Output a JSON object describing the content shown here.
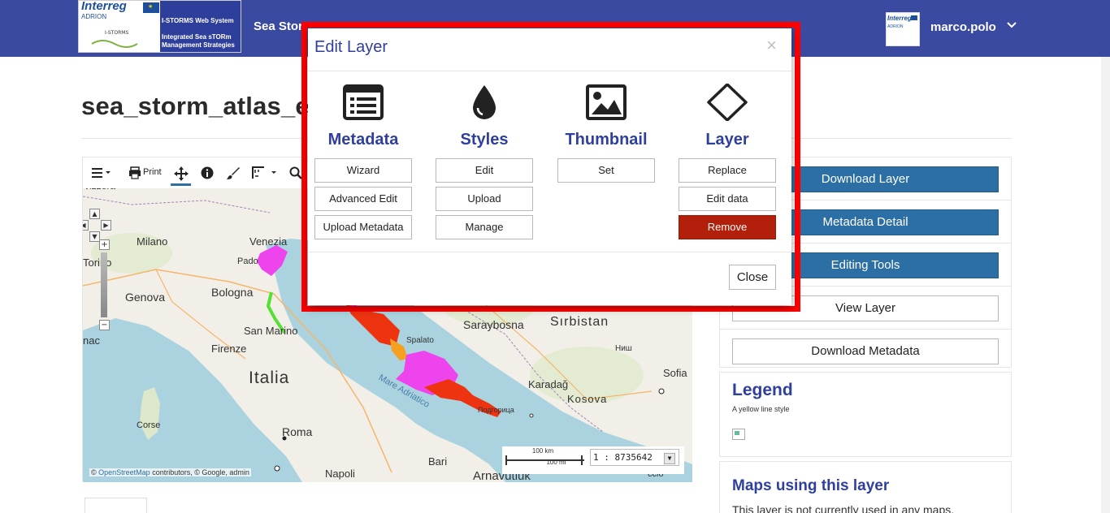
{
  "header": {
    "logo": {
      "interreg": "Interreg",
      "adrion": "ADRION",
      "istorms_small": "I-STORMS",
      "system_name": "I-STORMS Web System",
      "strategy": "Integrated Sea sTORm Management Strategies"
    },
    "brand_text": "Sea Stor",
    "user": {
      "avatar_text": "Interreg",
      "avatar_sub": "ADRION",
      "name": "marco.polo"
    },
    "colors": {
      "nav_bg": "#3a4aa0",
      "accent": "#2f3f9d",
      "primary_button": "#2c6fa5",
      "danger_button": "#b21f0a",
      "highlight": "#ff0000"
    }
  },
  "page": {
    "title": "sea_storm_atlas_e"
  },
  "map": {
    "toolbar": {
      "print_label": "Print",
      "icons": [
        "menu-icon",
        "print-icon",
        "pan-icon",
        "info-icon",
        "brush-icon",
        "measure-icon",
        "zoom-icon"
      ]
    },
    "labels": {
      "svizzera": "vizzera",
      "milano": "Milano",
      "venezia": "Venezia",
      "padova": "Pado",
      "torino": "Torino",
      "bologna": "Bologna",
      "genova": "Genova",
      "san_marino": "San Marino",
      "firenze": "Firenze",
      "italia": "Italia",
      "monaco": "nac",
      "corse": "Corse",
      "roma": "Roma",
      "napoli": "Napoli",
      "bari": "Bari",
      "arnavutluk": "Arnavutluk",
      "spalato": "Spalato",
      "saraybosna": "Saraybosna",
      "sirbistan": "Sırbistan",
      "nis": "Ниш",
      "sofia": "Sofia",
      "karadag": "Karadağ",
      "kosova": "Kosova",
      "podgorica": "Подгорица",
      "mare_adriatico": "Mare Adriatico",
      "ccio": "ccio",
      "ebrenik": "E..Urek"
    },
    "attribution": {
      "copyright": "©",
      "osm_link": "OpenStreetMap",
      "rest": "contributors, © Google, admin"
    },
    "scale": {
      "km": "100 km",
      "mi": "100 mi",
      "ratio": "1 : 8735642"
    }
  },
  "side": {
    "buttons": [
      {
        "label": "Download Layer",
        "style": "primary"
      },
      {
        "label": "Metadata Detail",
        "style": "primary"
      },
      {
        "label": "Editing Tools",
        "style": "primary"
      },
      {
        "label": "View Layer",
        "style": "default"
      },
      {
        "label": "Download Metadata",
        "style": "default"
      }
    ],
    "legend": {
      "title": "Legend",
      "subtitle": "A yellow line style"
    },
    "maps_using": {
      "title": "Maps using this layer",
      "text": "This layer is not currently used in any maps."
    }
  },
  "modal": {
    "title": "Edit Layer",
    "close_x": "×",
    "columns": [
      {
        "heading": "Metadata",
        "icon": "list-icon",
        "buttons": [
          {
            "label": "Wizard"
          },
          {
            "label": "Advanced Edit"
          },
          {
            "label": "Upload Metadata"
          }
        ]
      },
      {
        "heading": "Styles",
        "icon": "droplet-icon",
        "buttons": [
          {
            "label": "Edit"
          },
          {
            "label": "Upload"
          },
          {
            "label": "Manage"
          }
        ]
      },
      {
        "heading": "Thumbnail",
        "icon": "image-icon",
        "buttons": [
          {
            "label": "Set"
          }
        ]
      },
      {
        "heading": "Layer",
        "icon": "diamond-icon",
        "buttons": [
          {
            "label": "Replace"
          },
          {
            "label": "Edit data"
          },
          {
            "label": "Remove",
            "style": "danger"
          }
        ]
      }
    ],
    "close_button": "Close"
  }
}
